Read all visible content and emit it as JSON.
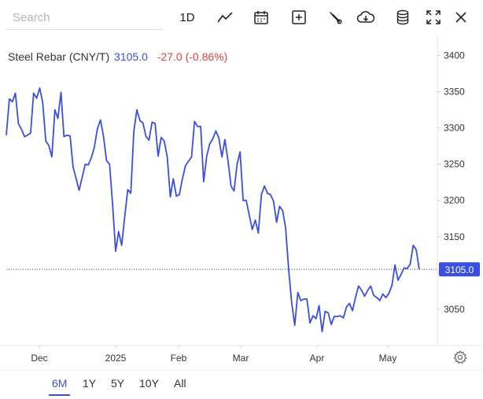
{
  "search": {
    "placeholder": "Search"
  },
  "toolbar": {
    "period_label": "1D",
    "icons": [
      "line-chart-icon",
      "calendar-icon",
      "plus-box-icon",
      "wrench-icon",
      "cloud-download-icon",
      "database-icon",
      "fullscreen-icon",
      "close-icon"
    ]
  },
  "legend": {
    "name": "Steel Rebar (CNY/T)",
    "price": "3105.0",
    "change": "-27.0 (-0.86%)"
  },
  "range_tabs": [
    "6M",
    "1Y",
    "5Y",
    "10Y",
    "All"
  ],
  "active_range": "6M",
  "colors": {
    "line": "#3a4fe0",
    "negative": "#e8403f",
    "last_price_box": "#3a4fe0"
  },
  "chart_data": {
    "type": "line",
    "title": "Steel Rebar (CNY/T)",
    "ylim": [
      3000,
      3420
    ],
    "y_ticks": [
      3050,
      3100,
      3150,
      3200,
      3250,
      3300,
      3350,
      3400
    ],
    "y_tick_labels": [
      "3050",
      "3100",
      "3150",
      "3200",
      "3250",
      "3300",
      "3350",
      "3400"
    ],
    "x_tick_labels": [
      "Dec",
      "2025",
      "Feb",
      "Mar",
      "Apr",
      "May"
    ],
    "last_value_label": "3105.0",
    "reference_line": 3105,
    "series": [
      {
        "values": [
          3290,
          3340,
          3336,
          3348,
          3306,
          3298,
          3288,
          3290,
          3293,
          3348,
          3341,
          3355,
          3335,
          3282,
          3276,
          3260,
          3325,
          3313,
          3349,
          3288,
          3290,
          3289,
          3246,
          3230,
          3214,
          3232,
          3250,
          3249,
          3259,
          3273,
          3299,
          3311,
          3289,
          3255,
          3250,
          3195,
          3130,
          3157,
          3138,
          3178,
          3215,
          3210,
          3295,
          3325,
          3310,
          3307,
          3288,
          3283,
          3308,
          3306,
          3261,
          3287,
          3282,
          3260,
          3205,
          3230,
          3206,
          3208,
          3230,
          3248,
          3254,
          3260,
          3309,
          3302,
          3302,
          3226,
          3261,
          3278,
          3285,
          3296,
          3286,
          3260,
          3284,
          3255,
          3220,
          3213,
          3250,
          3267,
          3200,
          3200,
          3180,
          3160,
          3173,
          3155,
          3208,
          3220,
          3210,
          3208,
          3199,
          3170,
          3192,
          3186,
          3162,
          3104,
          3058,
          3028,
          3073,
          3062,
          3064,
          3064,
          3031,
          3041,
          3037,
          3055,
          3019,
          3047,
          3045,
          3029,
          3040,
          3040,
          3041,
          3038,
          3053,
          3058,
          3048,
          3066,
          3082,
          3076,
          3068,
          3076,
          3082,
          3069,
          3066,
          3062,
          3071,
          3066,
          3072,
          3083,
          3111,
          3090,
          3098,
          3107,
          3106,
          3112,
          3138,
          3132,
          3105
        ]
      }
    ]
  }
}
